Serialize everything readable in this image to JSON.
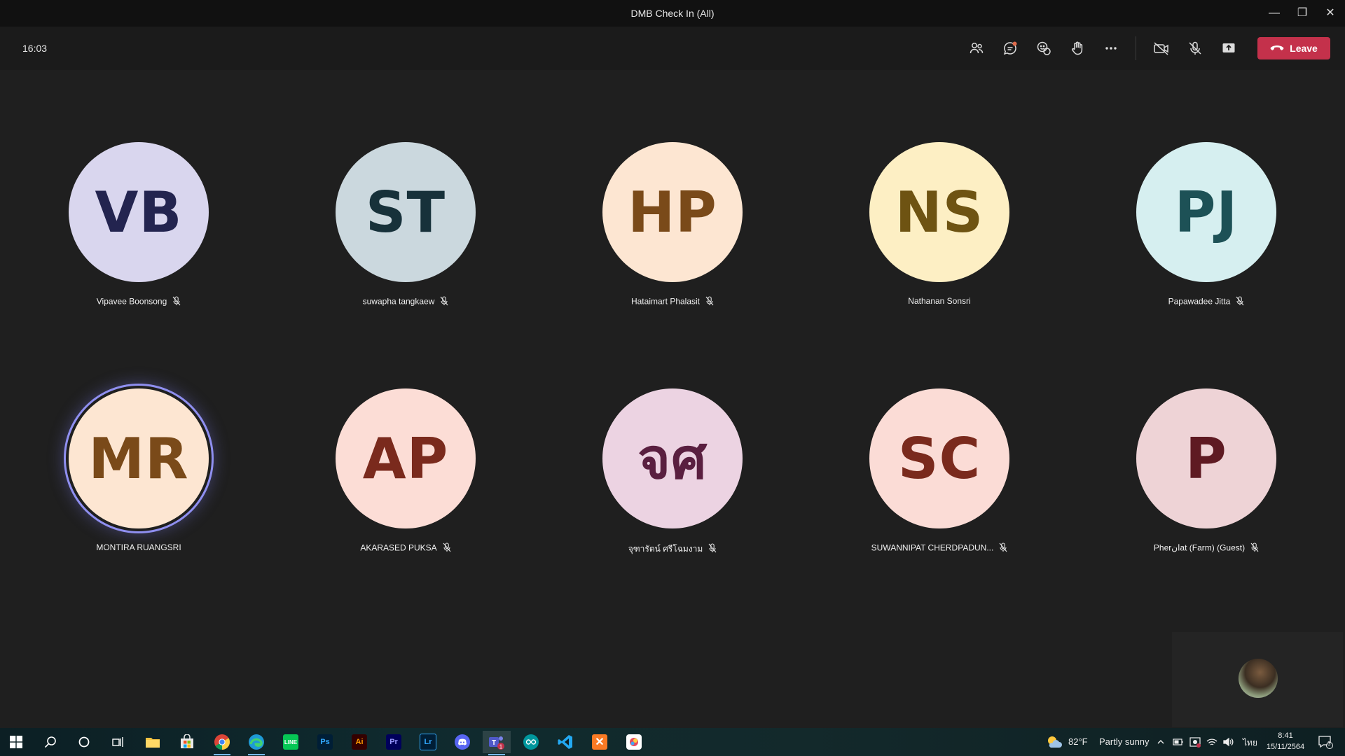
{
  "window": {
    "title": "DMB Check In (All)",
    "minimize_icon": "—",
    "restore_icon": "❐",
    "close_icon": "✕"
  },
  "toolbar": {
    "timer": "16:03",
    "leave_label": "Leave",
    "icons": [
      "people-icon",
      "chat-icon",
      "reactions-icon",
      "raise-hand-icon",
      "more-options-icon",
      "camera-off-icon",
      "mic-off-icon",
      "share-screen-icon"
    ],
    "chat_notification_color": "#e06b4b",
    "leave_color": "#c4314b"
  },
  "participants": [
    {
      "initials": "VB",
      "name": "Vipavee Boonsong",
      "muted": true,
      "bg": "#d9d6ee",
      "fg": "#23244f"
    },
    {
      "initials": "ST",
      "name": "suwapha tangkaew",
      "muted": true,
      "bg": "#cbd8de",
      "fg": "#17313a"
    },
    {
      "initials": "HP",
      "name": "Hataimart Phalasit",
      "muted": true,
      "bg": "#fde6d2",
      "fg": "#7a4a19"
    },
    {
      "initials": "NS",
      "name": "Nathanan Sonsri",
      "muted": false,
      "bg": "#fdefc4",
      "fg": "#6e5312"
    },
    {
      "initials": "PJ",
      "name": "Papawadee Jitta",
      "muted": true,
      "bg": "#d6eff0",
      "fg": "#1d5156"
    },
    {
      "initials": "MR",
      "name": "MONTIRA RUANGSRI",
      "muted": false,
      "bg": "#fde6d2",
      "fg": "#7a4a19",
      "speaking": true
    },
    {
      "initials": "AP",
      "name": "AKARASED PUKSA",
      "muted": true,
      "bg": "#fcddd6",
      "fg": "#7a2a1d"
    },
    {
      "initials": "จศ",
      "name": "จุฑารัตน์ ศรีโฉมงาม",
      "muted": true,
      "bg": "#ecd3e2",
      "fg": "#5a1f40"
    },
    {
      "initials": "SC",
      "name": "SUWANNIPAT CHERDPADUN...",
      "muted": true,
      "bg": "#fbdcd6",
      "fg": "#7a2a1d"
    },
    {
      "initials": "P",
      "name": "Pherانat (Farm) (Guest)",
      "muted": true,
      "bg": "#eed3d6",
      "fg": "#5e1a22"
    }
  ],
  "taskbar": {
    "apps": [
      "windows-start-icon",
      "search-icon",
      "cortana-icon",
      "task-view-icon",
      "file-explorer-icon",
      "microsoft-store-icon",
      "chrome-icon",
      "edge-icon",
      "line-icon",
      "photoshop-icon",
      "illustrator-icon",
      "premiere-icon",
      "lightroom-icon",
      "discord-icon",
      "teams-icon",
      "arduino-icon",
      "vscode-icon",
      "xampp-icon",
      "paint-icon"
    ],
    "weather_temp": "82°F",
    "weather_text": "Partly sunny",
    "language": "ไทย",
    "time": "8:41",
    "date": "15/11/2564",
    "notifications": "3"
  }
}
